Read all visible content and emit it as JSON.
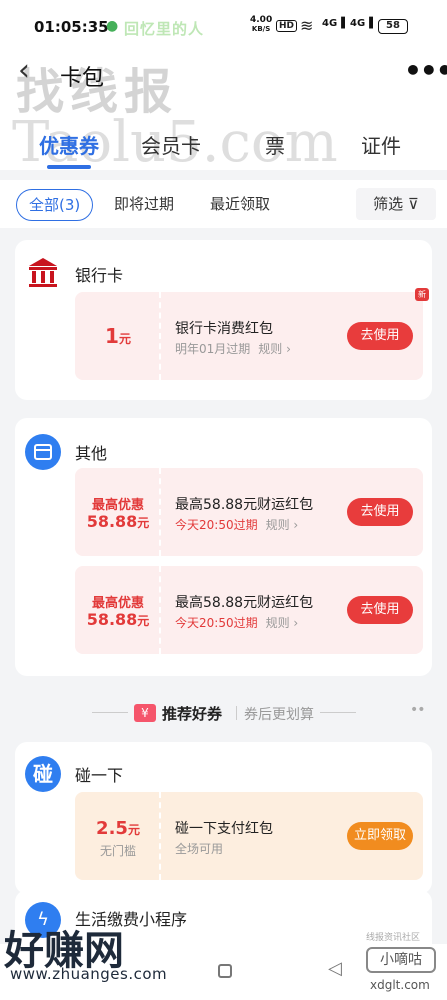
{
  "status_bar": {
    "time": "01:05:35",
    "notification": "回忆里的人",
    "speed_value": "4.00",
    "speed_unit": "KB/S",
    "hd": "HD",
    "signal1": "4G",
    "signal2": "4G",
    "battery": "58"
  },
  "header": {
    "title": "卡包",
    "watermark_top": "找线报",
    "watermark_url": "Taolu5.com"
  },
  "tabs": [
    "优惠券",
    "会员卡",
    "票",
    "证件"
  ],
  "filters": {
    "all": "全部(3)",
    "expiring": "即将过期",
    "recent": "最近领取",
    "filter": "筛选"
  },
  "bank_section": {
    "title": "银行卡",
    "coupon": {
      "amount": "1",
      "unit": "元",
      "name": "银行卡消费红包",
      "expiry": "明年01月过期",
      "rule": "规则",
      "button": "去使用",
      "badge": "新"
    }
  },
  "other_section": {
    "title": "其他",
    "coupons": [
      {
        "top": "最高优惠",
        "amount": "58.88",
        "unit": "元",
        "name": "最高58.88元财运红包",
        "expiry": "今天20:50过期",
        "rule": "规则",
        "button": "去使用"
      },
      {
        "top": "最高优惠",
        "amount": "58.88",
        "unit": "元",
        "name": "最高58.88元财运红包",
        "expiry": "今天20:50过期",
        "rule": "规则",
        "button": "去使用"
      }
    ]
  },
  "recommend": {
    "badge": "¥",
    "title": "推荐好券",
    "subtitle": "券后更划算"
  },
  "pengyixia_section": {
    "icon_char": "碰",
    "title": "碰一下",
    "coupon": {
      "amount": "2.5",
      "unit": "元",
      "note": "无门槛",
      "name": "碰一下支付红包",
      "scope": "全场可用",
      "button": "立即领取"
    }
  },
  "life_section": {
    "title": "生活缴费小程序"
  },
  "watermarks": {
    "bottom_left": "好赚网",
    "bottom_left_url": "www.zhuanges.com",
    "bottom_right": "小嘀咕",
    "bottom_right_url": "xdglt.com",
    "bottom_right_small": "线报资讯社区"
  },
  "colors": {
    "accent_blue": "#2f6fe3",
    "red": "#e23a3a",
    "orange": "#f18c1f"
  }
}
